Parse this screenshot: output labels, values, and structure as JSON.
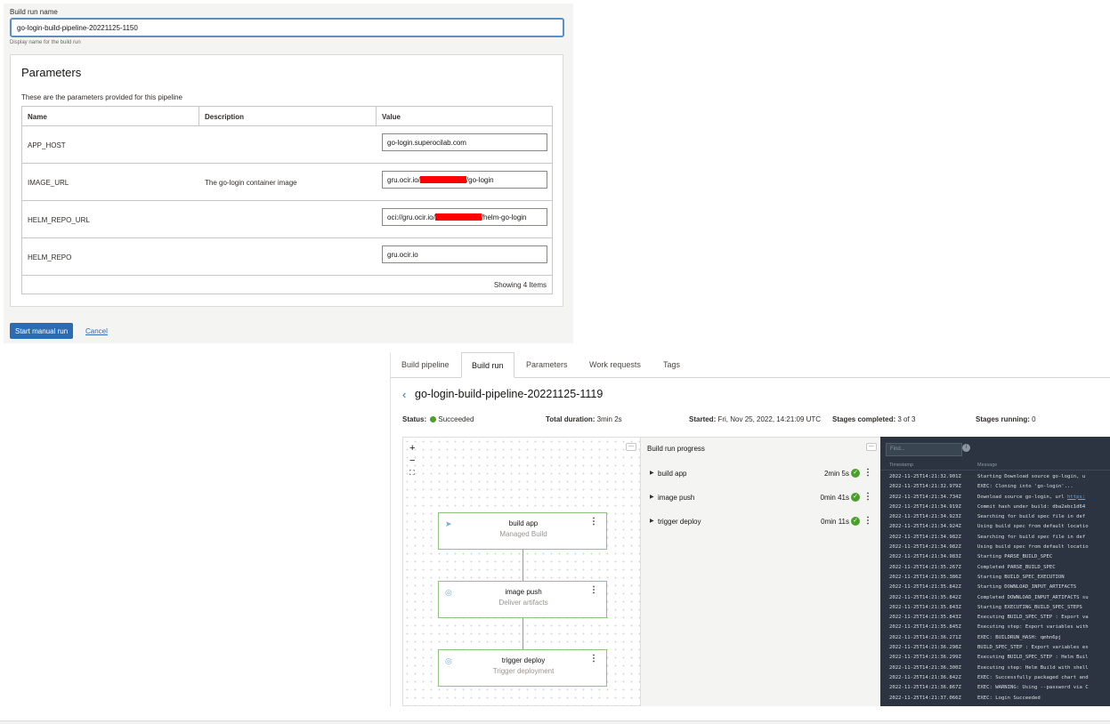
{
  "form": {
    "field_label": "Build run name",
    "run_name_value": "go-login-build-pipeline-20221125-1150",
    "hint": "Display name for the build run",
    "parameters": {
      "title": "Parameters",
      "subtitle": "These are the parameters provided for this pipeline",
      "columns": [
        "Name",
        "Description",
        "Value"
      ],
      "rows": [
        {
          "name": "APP_HOST",
          "description": "",
          "value_prefix": "go-login.superocilab.com",
          "value_suffix": ""
        },
        {
          "name": "IMAGE_URL",
          "description": "The go-login container image",
          "value_prefix": "gru.ocir.io/",
          "value_suffix": "/go-login"
        },
        {
          "name": "HELM_REPO_URL",
          "description": "",
          "value_prefix": "oci://gru.ocir.io/",
          "value_suffix": "/helm-go-login"
        },
        {
          "name": "HELM_REPO",
          "description": "",
          "value_prefix": "gru.ocir.io",
          "value_suffix": ""
        }
      ],
      "footer": "Showing 4 Items"
    },
    "start_button": "Start manual run",
    "cancel_link": "Cancel"
  },
  "run": {
    "tabs": [
      "Build pipeline",
      "Build run",
      "Parameters",
      "Work requests",
      "Tags"
    ],
    "active_tab": "Build run",
    "title": "go-login-build-pipeline-20221125-1119",
    "status_label": "Status:",
    "status_value": "Succeeded",
    "duration_label": "Total duration:",
    "duration_value": "3min 2s",
    "started_label": "Started:",
    "started_value": "Fri, Nov 25, 2022, 14:21:09 UTC",
    "stages_completed_label": "Stages completed:",
    "stages_completed_value": "3 of 3",
    "stages_running_label": "Stages running:",
    "stages_running_value": "0",
    "graph": {
      "zoom_in": "+",
      "zoom_out": "−",
      "fit": "⛶",
      "nodes": [
        {
          "name": "build app",
          "type": "Managed Build"
        },
        {
          "name": "image push",
          "type": "Deliver artifacts"
        },
        {
          "name": "trigger deploy",
          "type": "Trigger deployment"
        }
      ]
    },
    "progress": {
      "title": "Build run progress",
      "stages": [
        {
          "name": "build app",
          "duration": "2min 5s"
        },
        {
          "name": "image push",
          "duration": "0min 41s"
        },
        {
          "name": "trigger deploy",
          "duration": "0min 11s"
        }
      ]
    },
    "logs": {
      "find_placeholder": "Find...",
      "col_timestamp": "Timestamp",
      "col_message": "Message",
      "lines": [
        {
          "ts": "2022-11-25T14:21:32.901Z",
          "msg": "Starting Download source go-login, u"
        },
        {
          "ts": "2022-11-25T14:21:32.979Z",
          "msg": "EXEC: Cloning into 'go-login'..."
        },
        {
          "ts": "2022-11-25T14:21:34.734Z",
          "msg": "Download source go-login, url ",
          "link": "https:"
        },
        {
          "ts": "2022-11-25T14:21:34.919Z",
          "msg": "Commit hash under build: dba2ebc1d64"
        },
        {
          "ts": "2022-11-25T14:21:34.923Z",
          "msg": "Searching for build spec file in def"
        },
        {
          "ts": "2022-11-25T14:21:34.924Z",
          "msg": "Using build spec from default locatio"
        },
        {
          "ts": "2022-11-25T14:21:34.982Z",
          "msg": "Searching for build spec file in def"
        },
        {
          "ts": "2022-11-25T14:21:34.982Z",
          "msg": "Using build spec from default locatio"
        },
        {
          "ts": "2022-11-25T14:21:34.983Z",
          "msg": "Starting PARSE_BUILD_SPEC"
        },
        {
          "ts": "2022-11-25T14:21:35.267Z",
          "msg": "Completed PARSE_BUILD_SPEC"
        },
        {
          "ts": "2022-11-25T14:21:35.386Z",
          "msg": "Starting BUILD_SPEC_EXECUTION"
        },
        {
          "ts": "2022-11-25T14:21:35.842Z",
          "msg": "Starting DOWNLOAD_INPUT_ARTIFACTS"
        },
        {
          "ts": "2022-11-25T14:21:35.842Z",
          "msg": "Completed DOWNLOAD_INPUT_ARTIFACTS su"
        },
        {
          "ts": "2022-11-25T14:21:35.843Z",
          "msg": "Starting EXECUTING_BUILD_SPEC_STEPS"
        },
        {
          "ts": "2022-11-25T14:21:35.843Z",
          "msg": "Executing BUILD_SPEC_STEP : Export va"
        },
        {
          "ts": "2022-11-25T14:21:35.845Z",
          "msg": "Executing step: Export variables with"
        },
        {
          "ts": "2022-11-25T14:21:36.271Z",
          "msg": "EXEC: BUILDRUN_HASH:  qmhn6pj"
        },
        {
          "ts": "2022-11-25T14:21:36.298Z",
          "msg": "BUILD_SPEC_STEP : Export variables ex"
        },
        {
          "ts": "2022-11-25T14:21:36.299Z",
          "msg": "Executing BUILD_SPEC_STEP : Helm Buil"
        },
        {
          "ts": "2022-11-25T14:21:36.300Z",
          "msg": "Executing step: Helm Build with shell"
        },
        {
          "ts": "2022-11-25T14:21:36.842Z",
          "msg": "EXEC: Successfully packaged chart and"
        },
        {
          "ts": "2022-11-25T14:21:36.867Z",
          "msg": "EXEC: WARNING: Using --password via C"
        },
        {
          "ts": "2022-11-25T14:21:37.066Z",
          "msg": "EXEC: Login Succeeded"
        }
      ]
    }
  },
  "colors": {
    "primary_blue": "#2c6cb5",
    "success_green": "#4ba02c",
    "redaction_red": "#ff0000",
    "log_background": "#2b3440"
  }
}
